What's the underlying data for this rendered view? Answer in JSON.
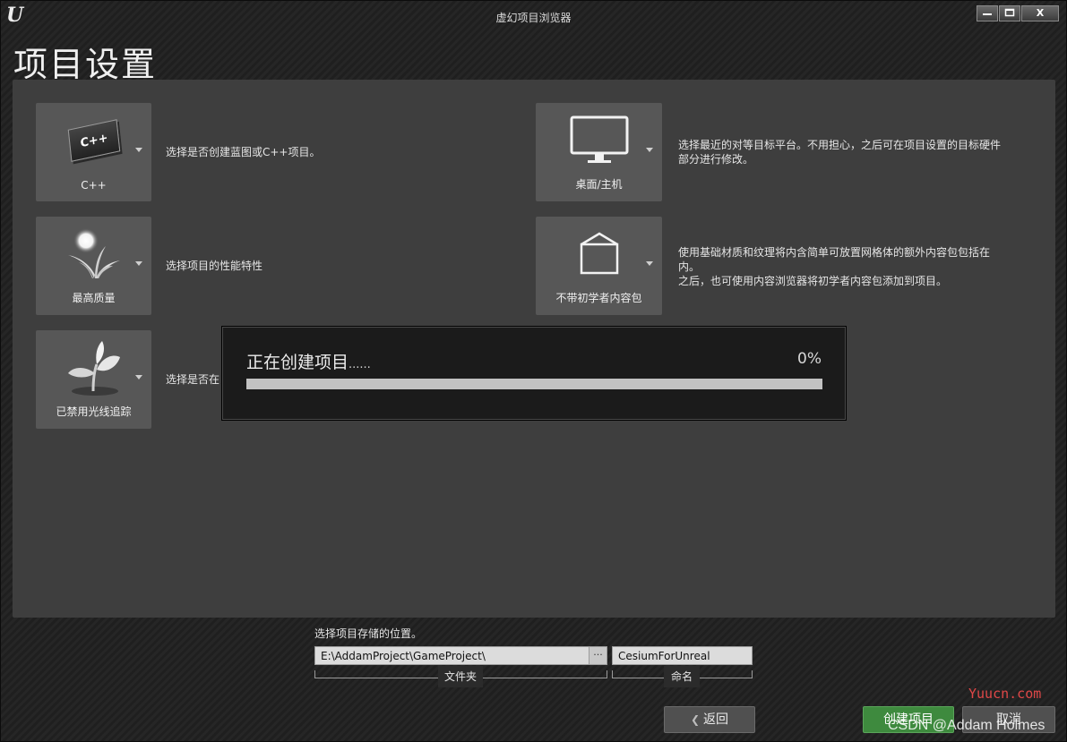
{
  "window": {
    "title": "虚幻项目浏览器",
    "logo": "UE",
    "controls": [
      "minimize-icon",
      "maximize-icon",
      "close-icon"
    ],
    "close_label": "X"
  },
  "page_title": "项目设置",
  "tiles": [
    {
      "label": "C++",
      "icon": "cpp-icon",
      "desc": "选择是否创建蓝图或C++项目。"
    },
    {
      "label": "最高质量",
      "icon": "quality-icon",
      "desc": "选择项目的性能特性"
    },
    {
      "label": "已禁用光线追踪",
      "icon": "raytracing-plant-icon",
      "desc": "选择是否在"
    },
    {
      "label": "桌面/主机",
      "icon": "monitor-icon",
      "desc_lines": [
        "选择最近的对等目标平台。不用担心，之后可在项目设置的目标硬件",
        "部分进行修改。"
      ]
    },
    {
      "label": "不带初学者内容包",
      "icon": "content-box-icon",
      "desc_lines": [
        "使用基础材质和纹理将内含简单可放置网格体的额外内容包包括在",
        "内。",
        "之后，也可使用内容浏览器将初学者内容包添加到项目。"
      ]
    }
  ],
  "progress": {
    "title": "正在创建项目",
    "dots": "......",
    "percent_label": "0%",
    "value": 0
  },
  "location": {
    "title": "选择项目存储的位置。",
    "path": "E:\\AddamProject\\GameProject\\",
    "browse_label": "···",
    "name": "CesiumForUnreal",
    "folder_label": "文件夹",
    "name_label": "命名"
  },
  "buttons": {
    "back": "返回",
    "create": "创建项目",
    "cancel": "取消"
  },
  "watermarks": {
    "site": "Yuucn.com",
    "author": "CSDN @Addam Holmes"
  }
}
